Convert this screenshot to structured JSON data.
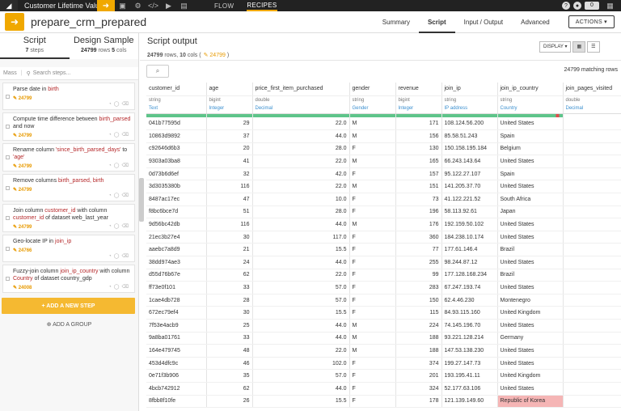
{
  "topbar": {
    "logo": "◢",
    "project_name": "Customer Lifetime Value",
    "nav": [
      "FLOW",
      "RECIPES"
    ],
    "zero": "0"
  },
  "recipe": {
    "name": "prepare_crm_prepared",
    "tabs": [
      "Summary",
      "Script",
      "Input / Output",
      "Advanced"
    ],
    "actions_label": "ACTIONS ▾"
  },
  "left": {
    "script_title": "Script",
    "script_sub_n": "7",
    "script_sub_label": "steps",
    "design_title": "Design Sample",
    "design_rows": "24799",
    "design_rows_label": "rows",
    "design_cols": "5",
    "design_cols_label": "cols",
    "mass_label": "Mass",
    "search_placeholder": "Search steps...",
    "add_step": "+ ADD A NEW STEP",
    "add_group": "⊕ ADD A GROUP",
    "steps": [
      {
        "pre": "Parse date in ",
        "r1": "birth",
        "mid": "",
        "r2": "",
        "post": "",
        "count": "24799"
      },
      {
        "pre": "Compute time difference between ",
        "r1": "birth_parsed",
        "mid": " and now",
        "r2": "",
        "post": "",
        "count": "24799"
      },
      {
        "pre": "Rename column ",
        "r1": "'since_birth_parsed_days'",
        "mid": " to ",
        "r2": "'age'",
        "post": "",
        "count": "24799"
      },
      {
        "pre": "Remove columns ",
        "r1": "birth_parsed, birth",
        "mid": "",
        "r2": "",
        "post": "",
        "count": "24799"
      },
      {
        "pre": "Join column ",
        "r1": "customer_id",
        "mid": " with column ",
        "r2": "customer_id",
        "post": " of dataset web_last_year",
        "count": "24799"
      },
      {
        "pre": "Geo-locate IP in ",
        "r1": "join_ip",
        "mid": "",
        "r2": "",
        "post": "",
        "count": "24766"
      },
      {
        "pre": "Fuzzy-join column ",
        "r1": "join_ip_country",
        "mid": " with column ",
        "r2": "Country",
        "post": " of dataset country_gdp",
        "count": "24008"
      }
    ]
  },
  "output": {
    "title": "Script output",
    "rows": "24799",
    "rows_label": "rows,",
    "cols": "10",
    "cols_label": "cols",
    "count_badge": "✎ 24799",
    "display_label": "DISPLAY ▾",
    "matching": "24799 matching rows",
    "filter_icon": "⌕"
  },
  "columns": [
    {
      "name": "customer_id",
      "type": "string",
      "meaning": "Text"
    },
    {
      "name": "age",
      "type": "bigint",
      "meaning": "Integer"
    },
    {
      "name": "price_first_item_purchased",
      "type": "double",
      "meaning": "Decimal"
    },
    {
      "name": "gender",
      "type": "string",
      "meaning": "Gender"
    },
    {
      "name": "revenue",
      "type": "bigint",
      "meaning": "Integer"
    },
    {
      "name": "join_ip",
      "type": "string",
      "meaning": "IP address"
    },
    {
      "name": "join_ip_country",
      "type": "string",
      "meaning": "Country"
    },
    {
      "name": "join_pages_visited",
      "type": "double",
      "meaning": "Decimal"
    }
  ],
  "rows": [
    [
      "041b77595d",
      "29",
      "22.0",
      "M",
      "171",
      "108.124.56.200",
      "United States",
      ""
    ],
    [
      "10863d9892",
      "37",
      "44.0",
      "M",
      "156",
      "85.58.51.243",
      "Spain",
      ""
    ],
    [
      "c92646d6b3",
      "20",
      "28.0",
      "F",
      "130",
      "150.158.195.184",
      "Belgium",
      ""
    ],
    [
      "9303a03ba8",
      "41",
      "22.0",
      "M",
      "165",
      "66.243.143.64",
      "United States",
      ""
    ],
    [
      "0d73b6d6ef",
      "32",
      "42.0",
      "F",
      "157",
      "95.122.27.107",
      "Spain",
      ""
    ],
    [
      "3d3035380b",
      "116",
      "22.0",
      "M",
      "151",
      "141.205.37.70",
      "United States",
      ""
    ],
    [
      "8487ac17ec",
      "47",
      "10.0",
      "F",
      "73",
      "41.122.221.52",
      "South Africa",
      ""
    ],
    [
      "f8bc6bce7d",
      "51",
      "28.0",
      "F",
      "196",
      "58.113.92.61",
      "Japan",
      ""
    ],
    [
      "9d56bc42db",
      "116",
      "44.0",
      "M",
      "176",
      "192.159.50.102",
      "United States",
      ""
    ],
    [
      "21ec3b27e4",
      "30",
      "117.0",
      "F",
      "360",
      "184.238.10.174",
      "United States",
      ""
    ],
    [
      "aaebc7a8d9",
      "21",
      "15.5",
      "F",
      "77",
      "177.61.146.4",
      "Brazil",
      ""
    ],
    [
      "38dd974ae3",
      "24",
      "44.0",
      "F",
      "255",
      "98.244.87.12",
      "United States",
      ""
    ],
    [
      "d55d76b67e",
      "62",
      "22.0",
      "F",
      "99",
      "177.128.168.234",
      "Brazil",
      ""
    ],
    [
      "ff73e0f101",
      "33",
      "57.0",
      "F",
      "283",
      "67.247.193.74",
      "United States",
      ""
    ],
    [
      "1cae4db728",
      "28",
      "57.0",
      "F",
      "150",
      "62.4.46.230",
      "Montenegro",
      ""
    ],
    [
      "672ec79ef4",
      "30",
      "15.5",
      "F",
      "115",
      "84.93.115.160",
      "United Kingdom",
      ""
    ],
    [
      "7f53e4acb9",
      "25",
      "44.0",
      "M",
      "224",
      "74.145.196.70",
      "United States",
      ""
    ],
    [
      "9a8ba01761",
      "33",
      "44.0",
      "M",
      "188",
      "93.221.128.214",
      "Germany",
      ""
    ],
    [
      "164e479745",
      "48",
      "22.0",
      "M",
      "188",
      "147.53.138.230",
      "United States",
      ""
    ],
    [
      "453d4dfc9c",
      "46",
      "102.0",
      "F",
      "374",
      "199.27.147.73",
      "United States",
      ""
    ],
    [
      "0e71f3b906",
      "35",
      "57.0",
      "F",
      "201",
      "193.195.41.11",
      "United Kingdom",
      ""
    ],
    [
      "4bcb742912",
      "62",
      "44.0",
      "F",
      "324",
      "52.177.63.106",
      "United States",
      ""
    ],
    [
      "8fbb8f10fe",
      "26",
      "15.5",
      "F",
      "178",
      "121.139.149.60",
      "Republic of Korea",
      ""
    ]
  ]
}
